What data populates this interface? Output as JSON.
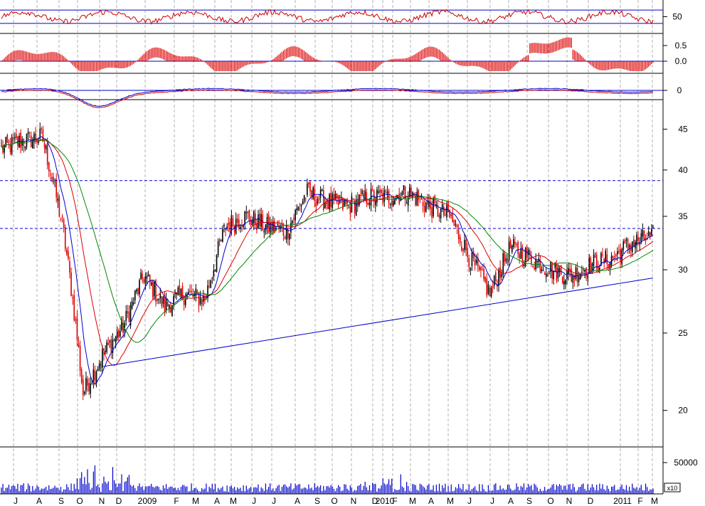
{
  "chart_data": {
    "type": "candlestick",
    "panels": [
      {
        "name": "rsi",
        "type": "line",
        "y_ticks": [
          "50"
        ],
        "reference_levels": [
          70,
          30
        ],
        "colors": {
          "line": "#cc0000",
          "reference": "#0000cc"
        }
      },
      {
        "name": "histogram",
        "type": "bar",
        "y_ticks": [
          "0.5",
          "0.0"
        ],
        "colors": {
          "bars": "#dd0000",
          "zero_line": "#0000cc"
        }
      },
      {
        "name": "oscillator",
        "type": "line",
        "y_ticks": [
          "0"
        ],
        "colors": {
          "fast": "#0000cc",
          "slow": "#cc0000",
          "zero_line": "#0000cc"
        }
      },
      {
        "name": "price",
        "type": "candlestick",
        "scale": "log",
        "y_ticks": [
          "45",
          "40",
          "35",
          "30",
          "25",
          "20"
        ],
        "ylim": [
          18,
          49
        ],
        "resistance_levels": [
          38.8,
          33.8
        ],
        "trendline": {
          "from": [
            "2008-11",
            22.7
          ],
          "to": [
            "2011-02",
            29.3
          ]
        },
        "moving_averages": [
          {
            "color": "#0000cc"
          },
          {
            "color": "#dd0000"
          },
          {
            "color": "#008800"
          }
        ],
        "series": [
          {
            "month": "2008-06",
            "close": 42.5
          },
          {
            "month": "2008-07",
            "close": 43.5
          },
          {
            "month": "2008-08",
            "close": 44.0
          },
          {
            "month": "2008-09",
            "close": 34.0
          },
          {
            "month": "2008-10",
            "close": 21.0
          },
          {
            "month": "2008-11",
            "close": 23.5
          },
          {
            "month": "2008-12",
            "close": 25.5
          },
          {
            "month": "2009-01",
            "close": 29.5
          },
          {
            "month": "2009-02",
            "close": 27.0
          },
          {
            "month": "2009-03",
            "close": 28.0
          },
          {
            "month": "2009-04",
            "close": 27.5
          },
          {
            "month": "2009-05",
            "close": 34.0
          },
          {
            "month": "2009-06",
            "close": 35.0
          },
          {
            "month": "2009-07",
            "close": 34.0
          },
          {
            "month": "2009-08",
            "close": 33.5
          },
          {
            "month": "2009-09",
            "close": 37.5
          },
          {
            "month": "2009-10",
            "close": 36.5
          },
          {
            "month": "2009-11",
            "close": 36.0
          },
          {
            "month": "2009-12",
            "close": 37.0
          },
          {
            "month": "2010-01",
            "close": 37.0
          },
          {
            "month": "2010-02",
            "close": 37.5
          },
          {
            "month": "2010-03",
            "close": 36.0
          },
          {
            "month": "2010-04",
            "close": 35.0
          },
          {
            "month": "2010-05",
            "close": 31.0
          },
          {
            "month": "2010-06",
            "close": 28.0
          },
          {
            "month": "2010-07",
            "close": 32.0
          },
          {
            "month": "2010-08",
            "close": 31.0
          },
          {
            "month": "2010-09",
            "close": 30.0
          },
          {
            "month": "2010-10",
            "close": 29.5
          },
          {
            "month": "2010-11",
            "close": 30.5
          },
          {
            "month": "2010-12",
            "close": 31.0
          },
          {
            "month": "2011-01",
            "close": 32.5
          },
          {
            "month": "2011-02",
            "close": 33.0
          }
        ],
        "colors": {
          "up": "#000000",
          "down": "#dd0000"
        }
      },
      {
        "name": "volume",
        "type": "bar",
        "y_ticks": [
          "50000"
        ],
        "unit_note": "x10",
        "colors": {
          "bars": "#0000cc"
        }
      }
    ],
    "x_axis": {
      "labels": [
        "J",
        "A",
        "S",
        "O",
        "N",
        "D",
        "2009",
        "F",
        "M",
        "A",
        "M",
        "J",
        "J",
        "A",
        "S",
        "O",
        "N",
        "D",
        "2010",
        "F",
        "M",
        "A",
        "M",
        "J",
        "J",
        "A",
        "S",
        "O",
        "N",
        "D",
        "2011",
        "F",
        "M"
      ]
    },
    "grid": true,
    "grid_style": "vertical-dashed"
  }
}
